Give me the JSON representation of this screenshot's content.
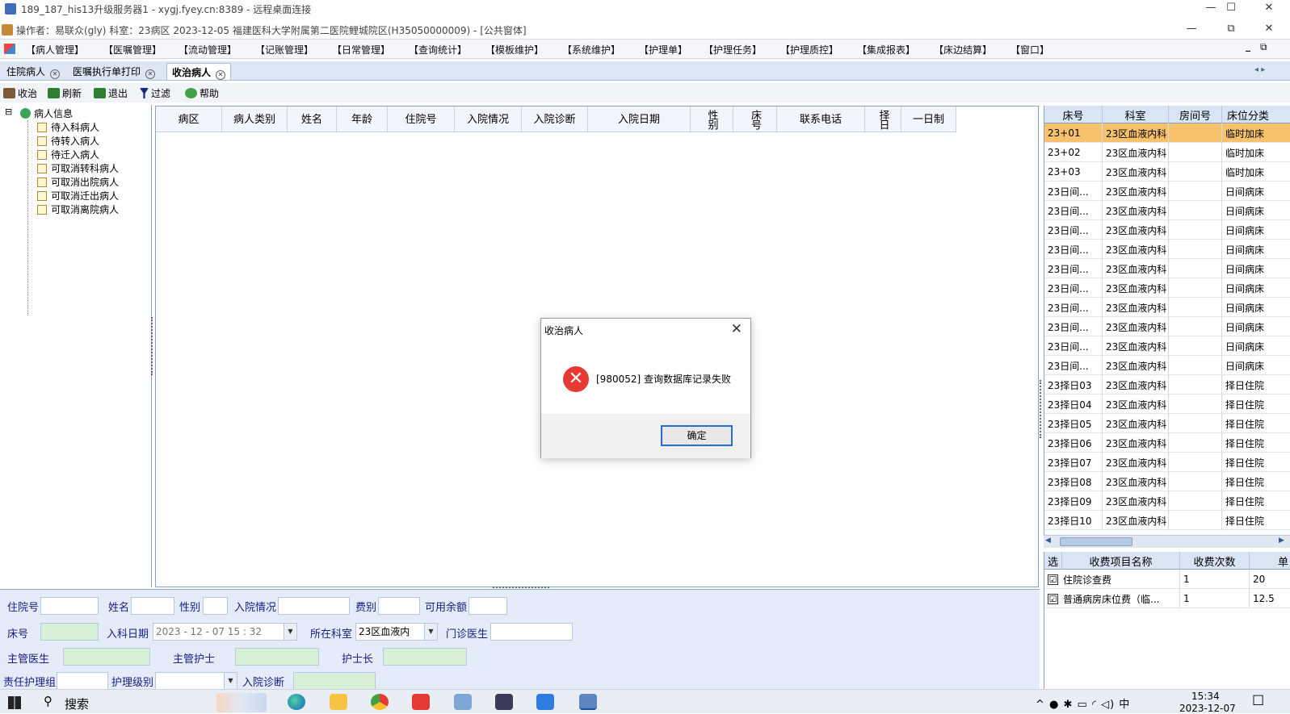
{
  "rdp_window": {
    "title": "189_187_his13升级服务器1 - xygj.fyey.cn:8389 - 远程桌面连接",
    "minimize": "—",
    "maximize": "☐",
    "close": "✕"
  },
  "app_window": {
    "title": "操作者：易联众(gly) 科室：23病区 2023-12-05 福建医科大学附属第二医院鲤城院区(H35050000009) - [公共窗体]",
    "minimize": "—",
    "restore": "⧉",
    "close": "✕"
  },
  "menu": [
    "【病人管理】",
    "【医嘱管理】",
    "【流动管理】",
    "【记账管理】",
    "【日常管理】",
    "【查询统计】",
    "【模板维护】",
    "【系统维护】",
    "【护理单】",
    "【护理任务】",
    "【护理质控】",
    "【集成报表】",
    "【床边结算】",
    "【窗口】"
  ],
  "menu_right": {
    "minimize": "_",
    "restore": "⧉"
  },
  "tabs": [
    {
      "label": "住院病人",
      "active": false
    },
    {
      "label": "医嘱执行单打印",
      "active": false
    },
    {
      "label": "收治病人",
      "active": true
    }
  ],
  "tab_scroll": "◂ ▸",
  "toolbar": [
    {
      "label": "收治",
      "icon": "admit-icon",
      "color": "#7a5a3a"
    },
    {
      "label": "刷新",
      "icon": "refresh-icon",
      "color": "#2e7d32"
    },
    {
      "label": "退出",
      "icon": "exit-icon",
      "color": "#2e7d32"
    },
    {
      "label": "过滤",
      "icon": "filter-icon",
      "color": "#1a237e"
    },
    {
      "label": "帮助",
      "icon": "help-icon",
      "color": "#43a047"
    }
  ],
  "tree": {
    "root": "病人信息",
    "expander": "⊟",
    "children": [
      "待入科病人",
      "待转入病人",
      "待迁入病人",
      "可取消转科病人",
      "可取消出院病人",
      "可取消迁出病人",
      "可取消离院病人"
    ]
  },
  "patient_grid": {
    "columns": [
      "病区",
      "病人类别",
      "姓名",
      "年龄",
      "住院号",
      "入院情况",
      "入院诊断",
      "入院日期",
      "性别",
      "床号",
      "联系电话",
      "择日",
      "一日制"
    ]
  },
  "bed_grid": {
    "columns": [
      "床号",
      "科室",
      "房间号",
      "床位分类"
    ],
    "rows": [
      {
        "bed": "23+01",
        "dept": "23区血液内科",
        "room": "",
        "type": "临时加床",
        "selected": true
      },
      {
        "bed": "23+02",
        "dept": "23区血液内科",
        "room": "",
        "type": "临时加床",
        "selected": false
      },
      {
        "bed": "23+03",
        "dept": "23区血液内科",
        "room": "",
        "type": "临时加床",
        "selected": false
      },
      {
        "bed": "23日间...",
        "dept": "23区血液内科",
        "room": "",
        "type": "日间病床",
        "selected": false
      },
      {
        "bed": "23日间...",
        "dept": "23区血液内科",
        "room": "",
        "type": "日间病床",
        "selected": false
      },
      {
        "bed": "23日间...",
        "dept": "23区血液内科",
        "room": "",
        "type": "日间病床",
        "selected": false
      },
      {
        "bed": "23日间...",
        "dept": "23区血液内科",
        "room": "",
        "type": "日间病床",
        "selected": false
      },
      {
        "bed": "23日间...",
        "dept": "23区血液内科",
        "room": "",
        "type": "日间病床",
        "selected": false
      },
      {
        "bed": "23日间...",
        "dept": "23区血液内科",
        "room": "",
        "type": "日间病床",
        "selected": false
      },
      {
        "bed": "23日间...",
        "dept": "23区血液内科",
        "room": "",
        "type": "日间病床",
        "selected": false
      },
      {
        "bed": "23日间...",
        "dept": "23区血液内科",
        "room": "",
        "type": "日间病床",
        "selected": false
      },
      {
        "bed": "23日间...",
        "dept": "23区血液内科",
        "room": "",
        "type": "日间病床",
        "selected": false
      },
      {
        "bed": "23日间...",
        "dept": "23区血液内科",
        "room": "",
        "type": "日间病床",
        "selected": false
      },
      {
        "bed": "23择日03",
        "dept": "23区血液内科",
        "room": "",
        "type": "择日住院",
        "selected": false
      },
      {
        "bed": "23择日04",
        "dept": "23区血液内科",
        "room": "",
        "type": "择日住院",
        "selected": false
      },
      {
        "bed": "23择日05",
        "dept": "23区血液内科",
        "room": "",
        "type": "择日住院",
        "selected": false
      },
      {
        "bed": "23择日06",
        "dept": "23区血液内科",
        "room": "",
        "type": "择日住院",
        "selected": false
      },
      {
        "bed": "23择日07",
        "dept": "23区血液内科",
        "room": "",
        "type": "择日住院",
        "selected": false
      },
      {
        "bed": "23择日08",
        "dept": "23区血液内科",
        "room": "",
        "type": "择日住院",
        "selected": false
      },
      {
        "bed": "23择日09",
        "dept": "23区血液内科",
        "room": "",
        "type": "择日住院",
        "selected": false
      },
      {
        "bed": "23择日10",
        "dept": "23区血液内科",
        "room": "",
        "type": "择日住院",
        "selected": false
      }
    ]
  },
  "fee_grid": {
    "columns": [
      "选",
      "收费项目名称",
      "收费次数",
      "单"
    ],
    "rows": [
      {
        "checked": "☑",
        "name": "住院诊查费",
        "count": "1",
        "price": "20"
      },
      {
        "checked": "☑",
        "name": "普通病房床位费（临...",
        "count": "1",
        "price": "12.5"
      }
    ]
  },
  "form": {
    "inpatient_no_label": "住院号",
    "name_label": "姓名",
    "gender_label": "性别",
    "admission_status_label": "入院情况",
    "fee_type_label": "费别",
    "balance_label": "可用余额",
    "bed_no_label": "床号",
    "admit_date_label": "入科日期",
    "admit_date_value": "2023 - 12 - 07   15 : 32",
    "dept_label": "所在科室",
    "dept_value": "23区血液内",
    "clinic_doctor_label": "门诊医生",
    "attending_doctor_label": "主管医生",
    "attending_nurse_label": "主管护士",
    "head_nurse_label": "护士长",
    "nursing_group_label": "责任护理组",
    "nursing_level_label": "护理级别",
    "admission_diag_label": "入院诊断",
    "dropdown_glyph": "▼"
  },
  "dialog": {
    "title": "收治病人",
    "close": "✕",
    "error_glyph": "✕",
    "message": "[980052] 查询数据库记录失败",
    "ok_label": "确定"
  },
  "taskbar": {
    "search_label": "搜索",
    "tray_icons": "^ ● ✱ ▭ ◜ ◁) 中",
    "time": "15:34",
    "date": "2023-12-07",
    "notification_glyph": "☐"
  },
  "colors": {
    "selected_row": "#f7c26b",
    "form_bg": "#e3ecf8",
    "green_field": "#d8f0d8",
    "error_red": "#e53935",
    "ok_border": "#2a6bcf"
  }
}
